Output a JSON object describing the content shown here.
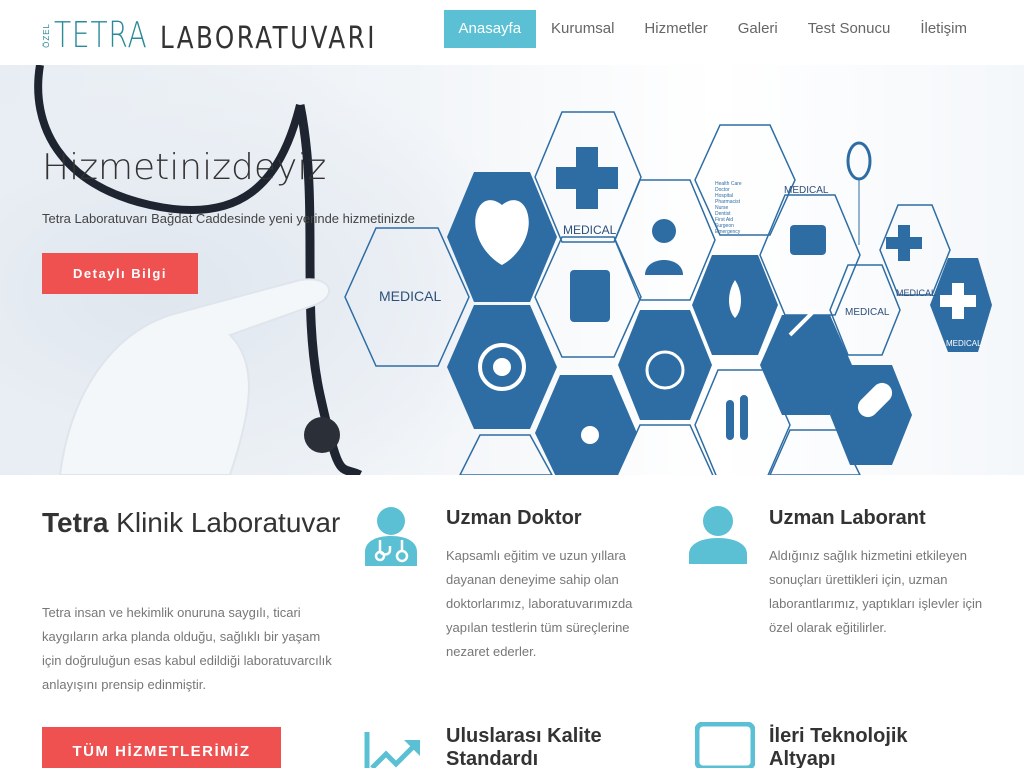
{
  "logo": {
    "small": "ÖZEL",
    "brand": "TETRA",
    "rest": "LABORATUVARI"
  },
  "nav": {
    "items": [
      {
        "label": "Anasayfa",
        "active": true
      },
      {
        "label": "Kurumsal"
      },
      {
        "label": "Hizmetler"
      },
      {
        "label": "Galeri"
      },
      {
        "label": "Test Sonucu"
      },
      {
        "label": "İletişim"
      }
    ]
  },
  "hero": {
    "title": "Hizmetinizdeyiz",
    "subtitle": "Tetra Laboratuvarı Bağdat Caddesinde yeni yerinde hizmetinizde",
    "button": "Detaylı Bilgi",
    "hex_labels": [
      "MEDICAL",
      "MEDICAL",
      "MEDICAL",
      "MEDICAL",
      "MEDICAL",
      "MEDICAL"
    ],
    "list_text": [
      "Health Care",
      "Doctor",
      "Hospital",
      "Pharmacist",
      "Nurse",
      "Dentist",
      "First Aid",
      "Surgeon",
      "Emergency"
    ]
  },
  "intro": {
    "title_bold": "Tetra",
    "title_rest": " Klinik Laboratuvar",
    "text": "Tetra insan ve hekimlik onuruna saygılı, ticari kaygıların arka planda olduğu, sağlıklı bir yaşam için doğruluğun esas kabul edildiği laboratuvarcılık anlayışını prensip edinmiştir.",
    "button": "TÜM HİZMETLERİMİZ"
  },
  "features": [
    {
      "icon": "doctor-icon",
      "title": "Uzman Doktor",
      "text": "Kapsamlı eğitim ve uzun yıllara dayanan deneyime sahip olan doktorlarımız, laboratuvarımızda yapılan testlerin tüm süreçlerine nezaret ederler."
    },
    {
      "icon": "user-icon",
      "title": "Uzman Laborant",
      "text": "Aldığınız sağlık hizmetini etkileyen sonuçları ürettikleri için, uzman laborantlarımız, yaptıkları işlevler için özel olarak eğitilirler."
    },
    {
      "icon": "trend-up-icon",
      "title": "Uluslarası Kalite Standardı",
      "text": ""
    },
    {
      "icon": "monitor-icon",
      "title": "İleri Teknolojik Altyapı",
      "text": ""
    }
  ],
  "colors": {
    "accent": "#5bc0d4",
    "button_red": "#ef5151",
    "hex_blue": "#2e6da4"
  }
}
